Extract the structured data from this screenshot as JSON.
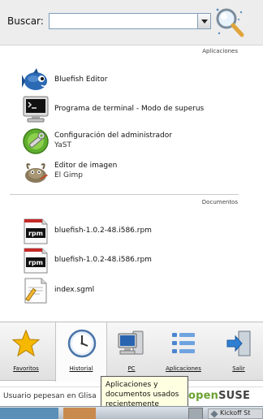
{
  "search": {
    "label": "Buscar:",
    "value": "",
    "placeholder": ""
  },
  "sections": {
    "applications": "Aplicaciones",
    "documents": "Documentos"
  },
  "applications": [
    {
      "title": "Bluefish Editor",
      "subtitle": "",
      "icon": "bluefish-icon"
    },
    {
      "title": "Programa de terminal - Modo de superusuario",
      "subtitle": "",
      "icon": "terminal-icon"
    },
    {
      "title": "Configuración del administrador",
      "subtitle": "YaST",
      "icon": "yast-icon"
    },
    {
      "title": "Editor de imagen",
      "subtitle": "El Gimp",
      "icon": "gimp-icon"
    }
  ],
  "documents": [
    {
      "title": "bluefish-1.0.2-48.i586.rpm",
      "icon": "rpm-icon"
    },
    {
      "title": "bluefish-1.0.2-48.i586.rpm",
      "icon": "rpm-icon"
    },
    {
      "title": "index.sgml",
      "icon": "text-document-icon"
    }
  ],
  "tabs": [
    {
      "label": "Favoritos",
      "icon": "star-icon"
    },
    {
      "label": "Historial",
      "icon": "clock-icon"
    },
    {
      "label": "PC",
      "icon": "computer-icon"
    },
    {
      "label": "Aplicaciones",
      "icon": "list-icon"
    },
    {
      "label": "Salir",
      "icon": "logout-icon"
    }
  ],
  "active_tab": "Historial",
  "status": {
    "user_text": "Usuario pepesan en Glisa",
    "brand_main": "open",
    "brand_suffix": "SUSE"
  },
  "tooltip": {
    "text": "Aplicaciones y documentos usados recientemente"
  },
  "taskbar": {
    "kickoff_label": "Kickoff St"
  },
  "colors": {
    "brand_green": "#6aa231",
    "tooltip_bg": "#ffffe1",
    "search_border": "#7f9db9"
  }
}
